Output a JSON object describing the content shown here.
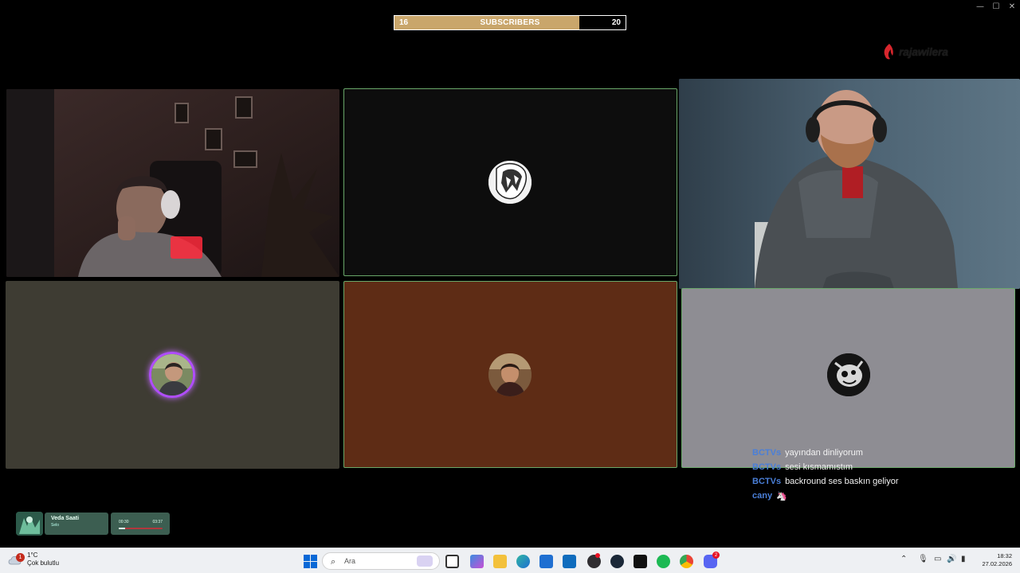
{
  "window": {
    "minimize": "—",
    "maximize": "☐",
    "close": "✕"
  },
  "sub_goal": {
    "current": "16",
    "label": "SUBSCRIBERS",
    "goal": "20",
    "progress": 0.8
  },
  "logo": {
    "name": "rajawilera"
  },
  "participants": [
    {
      "kind": "camera",
      "bg": "#2a1e1d"
    },
    {
      "kind": "avatar",
      "bg": "#0d0d0d",
      "icon": "anime-avatar-icon"
    },
    {
      "kind": "camera",
      "bg": "#3e5261"
    },
    {
      "kind": "avatar",
      "bg": "#3e3c33",
      "icon": "user-avatar-icon",
      "speaking": true
    },
    {
      "kind": "avatar",
      "bg": "#5e2c15",
      "icon": "user-avatar-icon"
    },
    {
      "kind": "avatar",
      "bg": "#8e8d93",
      "icon": "cartoon-avatar-icon"
    }
  ],
  "chat": [
    {
      "user": "BCTVs",
      "message": "yayından dinliyorum"
    },
    {
      "user": "BCTVs",
      "message": "sesi kısmamıstım"
    },
    {
      "user": "BCTVs",
      "message": "backround ses baskın geliyor"
    },
    {
      "user": "cany",
      "message": "🦄"
    }
  ],
  "now_playing": {
    "title": "Veda Saati",
    "artist": "Selo",
    "elapsed": "00:30",
    "duration": "03:37",
    "progress": 0.14
  },
  "taskbar": {
    "weather_temp": "1°C",
    "weather_desc": "Çok bulutlu",
    "weather_badge": "1",
    "search_placeholder": "Ara",
    "discord_badge": "2",
    "time": "18:32",
    "date": "27.02.2026"
  },
  "colors": {
    "accent_border": "#6aa86a",
    "chat_user": "#4a7fd8",
    "sub_fill": "#c9a66b"
  }
}
